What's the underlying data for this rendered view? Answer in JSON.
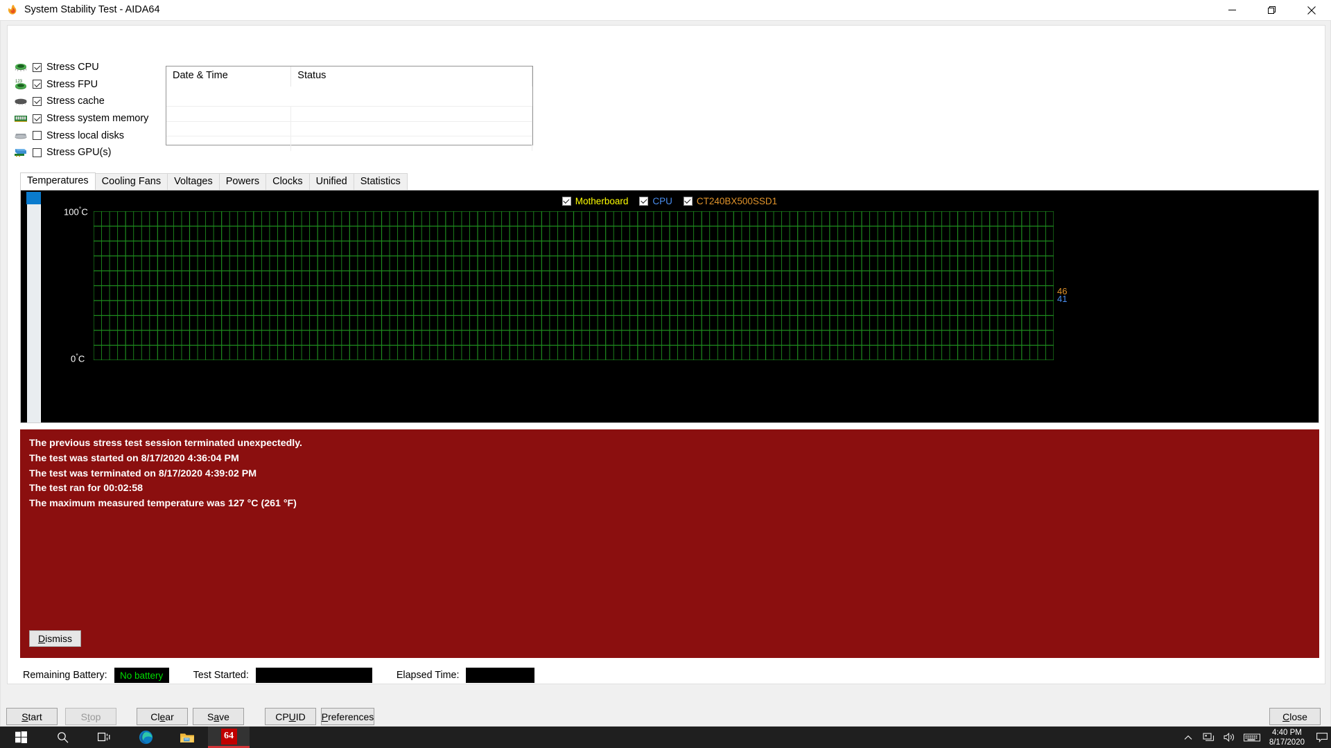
{
  "window": {
    "title": "System Stability Test - AIDA64",
    "app_icon": "flame-icon",
    "controls": {
      "minimize": "minimize-icon",
      "restore": "restore-icon",
      "close": "close-icon"
    }
  },
  "stress_options": [
    {
      "label": "Stress CPU",
      "checked": true,
      "icon": "cpu-chip-icon"
    },
    {
      "label": "Stress FPU",
      "checked": true,
      "icon": "fpu-chip-icon"
    },
    {
      "label": "Stress cache",
      "checked": true,
      "icon": "cache-chip-icon"
    },
    {
      "label": "Stress system memory",
      "checked": true,
      "icon": "memory-stick-icon"
    },
    {
      "label": "Stress local disks",
      "checked": false,
      "icon": "hard-disk-icon"
    },
    {
      "label": "Stress GPU(s)",
      "checked": false,
      "icon": "gpu-card-icon"
    }
  ],
  "log_table": {
    "columns": [
      "Date & Time",
      "Status"
    ],
    "rows": []
  },
  "tabs": [
    {
      "label": "Temperatures",
      "active": true
    },
    {
      "label": "Cooling Fans",
      "active": false
    },
    {
      "label": "Voltages",
      "active": false
    },
    {
      "label": "Powers",
      "active": false
    },
    {
      "label": "Clocks",
      "active": false
    },
    {
      "label": "Unified",
      "active": false
    },
    {
      "label": "Statistics",
      "active": false
    }
  ],
  "chart_data": {
    "type": "line",
    "title": "",
    "xlabel": "",
    "ylabel": "",
    "ylim": [
      0,
      100
    ],
    "y_tick_top": "100",
    "y_tick_bottom": "0",
    "y_unit": "C",
    "y_degree": "°",
    "grid": true,
    "grid_color": "#1e8c1e",
    "background": "#000000",
    "legend_position": "top-center",
    "x": [],
    "series": [
      {
        "name": "Motherboard",
        "color": "#ffff00",
        "checked": true,
        "values": [],
        "current": null
      },
      {
        "name": "CPU",
        "color": "#4a8ef0",
        "checked": true,
        "values": [],
        "current": 41
      },
      {
        "name": "CT240BX500SSD1",
        "color": "#e0932a",
        "checked": true,
        "values": [],
        "current": 46
      }
    ],
    "edge_values": [
      {
        "text": "46",
        "color": "#e0932a",
        "series": "CT240BX500SSD1"
      },
      {
        "text": "41",
        "color": "#4a8ef0",
        "series": "CPU"
      }
    ]
  },
  "alert": {
    "lines": [
      "The previous stress test session terminated unexpectedly.",
      "The test was started on 8/17/2020 4:36:04 PM",
      "The test was terminated on 8/17/2020 4:39:02 PM",
      "The test ran for 00:02:58",
      "The maximum measured temperature was 127 °C  (261 °F)"
    ],
    "dismiss_label": "Dismiss",
    "dismiss_accel": "D",
    "background": "#8b0f0f"
  },
  "status": {
    "battery_label": "Remaining Battery:",
    "battery_value": "No battery",
    "battery_color": "#00dd00",
    "test_started_label": "Test Started:",
    "test_started_value": "",
    "elapsed_label": "Elapsed Time:",
    "elapsed_value": ""
  },
  "buttons": [
    {
      "label": "Start",
      "accel": "S",
      "disabled": false
    },
    {
      "label": "Stop",
      "accel": "t",
      "disabled": true
    },
    {
      "label": "Clear",
      "accel": "e",
      "disabled": false
    },
    {
      "label": "Save",
      "accel": "a",
      "disabled": false
    },
    {
      "label": "CPUID",
      "accel": "U",
      "disabled": false
    },
    {
      "label": "Preferences",
      "accel": "P",
      "disabled": false
    },
    {
      "label": "Close",
      "accel": "C",
      "disabled": false
    }
  ],
  "taskbar": {
    "items": [
      {
        "name": "start-button",
        "icon": "windows-logo-icon",
        "active": false
      },
      {
        "name": "search-button",
        "icon": "search-icon",
        "active": false
      },
      {
        "name": "task-view",
        "icon": "task-view-icon",
        "active": false
      },
      {
        "name": "edge-browser",
        "icon": "edge-icon",
        "active": false
      },
      {
        "name": "file-explorer",
        "icon": "folder-icon",
        "active": false
      },
      {
        "name": "aida64-app",
        "icon": "aida64-icon",
        "active": true,
        "badge": "64"
      }
    ],
    "tray": [
      "chevron-up-icon",
      "network-icon",
      "volume-icon",
      "keyboard-icon"
    ],
    "clock_time": "4:40 PM",
    "clock_date": "8/17/2020",
    "notification": "notification-icon"
  }
}
